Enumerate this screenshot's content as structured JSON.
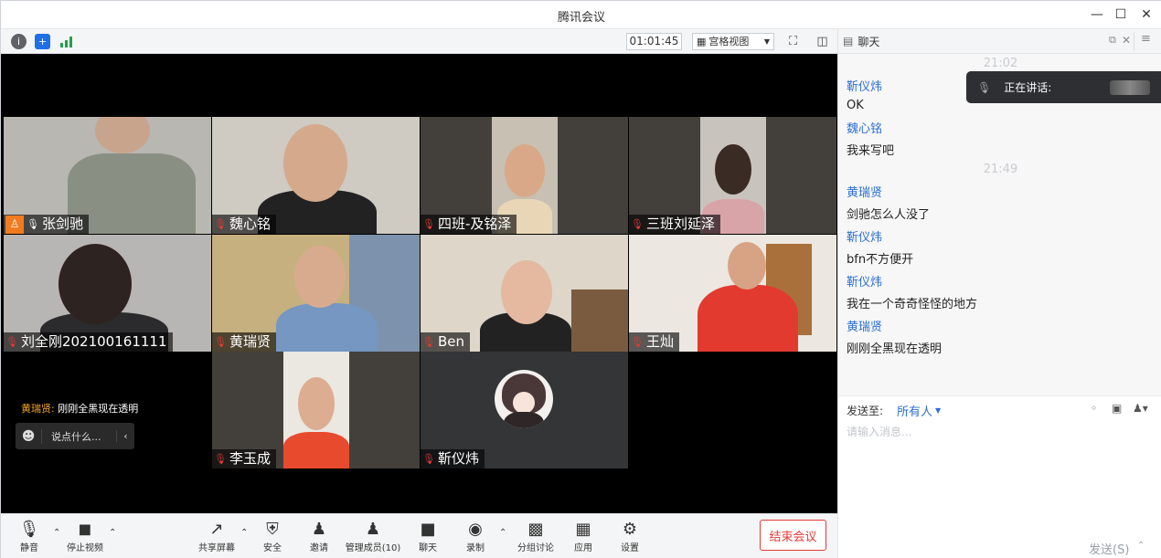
{
  "window": {
    "title": "腾讯会议"
  },
  "topbar": {
    "timer": "01:01:45",
    "view_label": "宫格视图"
  },
  "participants": [
    {
      "name": "张剑驰"
    },
    {
      "name": "魏心铭"
    },
    {
      "name": "四班-及铭泽"
    },
    {
      "name": "三班刘延泽"
    },
    {
      "name": "刘全刚202100161111"
    },
    {
      "name": "黄瑞贤"
    },
    {
      "name": "Ben"
    },
    {
      "name": "王灿"
    },
    {
      "name": "李玉成"
    },
    {
      "name": "靳仪炜"
    }
  ],
  "overlay": {
    "toast_sender": "黄瑞贤:",
    "toast_text": "刚刚全黑现在透明",
    "say_placeholder": "说点什么..."
  },
  "toolbar": {
    "mute": "静音",
    "stop_video": "停止视频",
    "share": "共享屏幕",
    "security": "安全",
    "invite": "邀请",
    "manage": "管理成员(10)",
    "chat": "聊天",
    "record": "录制",
    "breakout": "分组讨论",
    "apps": "应用",
    "settings": "设置",
    "end": "结束会议"
  },
  "chat": {
    "header": "聊天",
    "speaking_label": "正在讲话:",
    "messages": [
      {
        "time": "21:02"
      },
      {
        "sender": "靳仪炜",
        "text": "OK"
      },
      {
        "sender": "魏心铭",
        "text": "我来写吧"
      },
      {
        "time": "21:49"
      },
      {
        "sender": "黄瑞贤",
        "text": "剑驰怎么人没了"
      },
      {
        "sender": "靳仪炜",
        "text": "bfn不方便开"
      },
      {
        "sender": "靳仪炜",
        "text": "我在一个奇奇怪怪的地方"
      },
      {
        "sender": "黄瑞贤",
        "text": "刚刚全黑现在透明"
      }
    ],
    "send_to_label": "发送至:",
    "send_to_value": "所有人",
    "input_placeholder": "请输入消息...",
    "send_button": "发送(S)"
  }
}
